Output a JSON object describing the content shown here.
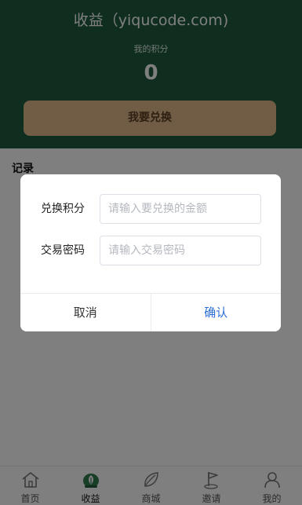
{
  "header": {
    "title": "收益（yiqucode.com)",
    "points_label": "我的积分",
    "points_value": "0",
    "exchange_button": "我要兑换"
  },
  "records": {
    "title": "记录"
  },
  "tabbar": {
    "items": [
      {
        "label": "首页",
        "icon": "home-icon"
      },
      {
        "label": "收益",
        "icon": "income-icon",
        "active": true
      },
      {
        "label": "商城",
        "icon": "mall-leaf-icon"
      },
      {
        "label": "邀请",
        "icon": "invite-flag-icon"
      },
      {
        "label": "我的",
        "icon": "profile-icon"
      }
    ]
  },
  "dialog": {
    "fields": [
      {
        "label": "兑换积分",
        "value": "",
        "placeholder": "请输入要兑换的金额"
      },
      {
        "label": "交易密码",
        "value": "",
        "placeholder": "请输入交易密码"
      }
    ],
    "cancel_label": "取消",
    "confirm_label": "确认"
  },
  "colors": {
    "header_bg": "#1f5d3e",
    "exchange_button_bg": "#e2b88c",
    "confirm_text": "#2a6fd6"
  }
}
